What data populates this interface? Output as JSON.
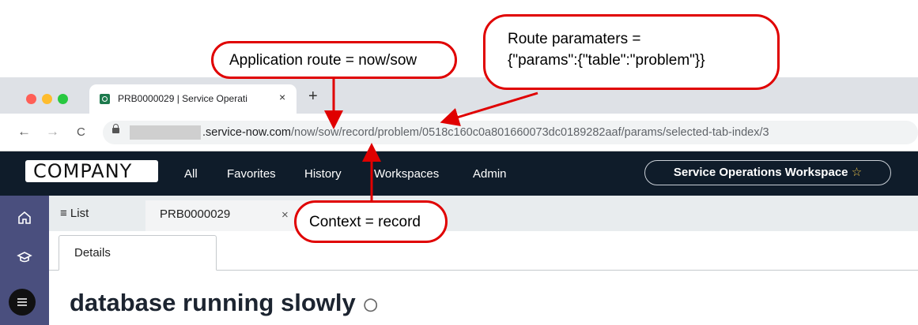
{
  "browser": {
    "tab_title": "PRB0000029 | Service Operati",
    "tab_close": "×",
    "new_tab": "+",
    "nav_back": "←",
    "nav_forward": "→",
    "nav_reload": "C",
    "url_domain": ".service-now.com",
    "url_path": "/now/sow/record/problem/0518c160c0a801660073dc0189282aaf/params/selected-tab-index/3"
  },
  "app": {
    "logo": "COMPANY",
    "menu": [
      "All",
      "Favorites",
      "History",
      "Workspaces",
      "Admin"
    ],
    "workspace_label": "Service Operations Workspace",
    "workspace_star": "☆"
  },
  "rail": {
    "home_icon": "home-icon",
    "learn_icon": "graduation-cap-icon",
    "list_icon": "list-icon"
  },
  "tabs": {
    "list_label": "≡ List",
    "record_tab": "PRB0000029",
    "record_tab_close": "×",
    "details_tab": "Details"
  },
  "record": {
    "title": "database running slowly"
  },
  "annotations": {
    "app_route": "Application route = now/sow",
    "route_params_line1": "Route paramaters =",
    "route_params_line2": "{\"params\":{\"table\":\"problem\"}}",
    "context": "Context = record"
  },
  "colors": {
    "appbar": "#0f1c2a",
    "rail": "#4a4f7e",
    "annotation": "#e00000"
  }
}
